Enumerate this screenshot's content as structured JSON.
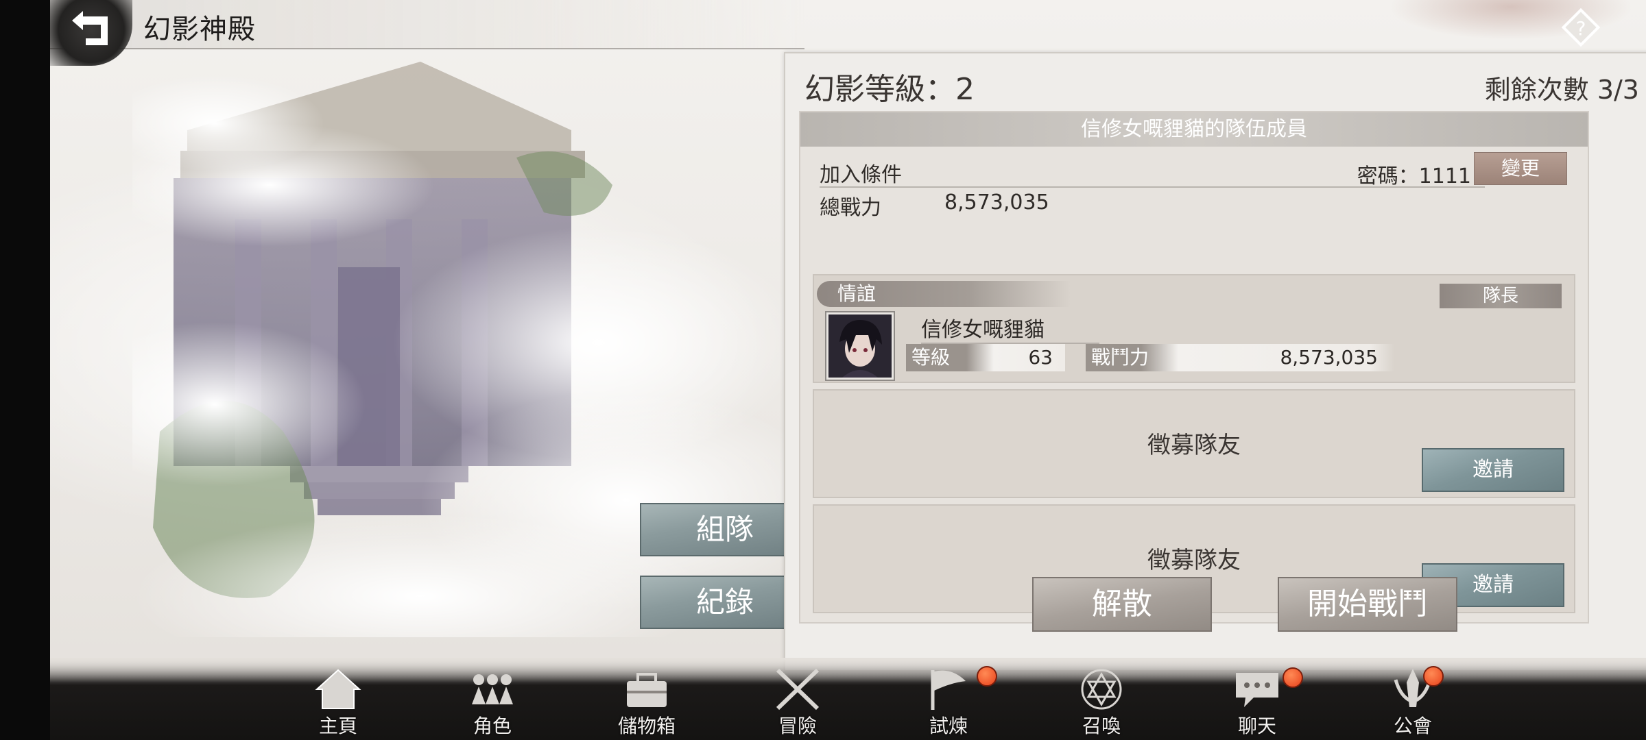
{
  "page": {
    "title": "幻影神殿"
  },
  "panel": {
    "phantom_level": "幻影等級：2",
    "remaining": "剩餘次數 3/3",
    "team_header": "信修女嘅貍貓的隊伍成員",
    "join_label": "加入條件",
    "password": "密碼：1111",
    "change_label": "變更",
    "total_power_label": "總戰力",
    "total_power_value": "8,573,035",
    "member": {
      "tag": "情誼",
      "leader_label": "隊長",
      "name": "信修女嘅貍貓",
      "level_label": "等級",
      "level": "63",
      "power_label": "戰鬥力",
      "power": "8,573,035"
    },
    "slots": [
      {
        "text": "徵募隊友",
        "invite_label": "邀請"
      },
      {
        "text": "徵募隊友",
        "invite_label": "邀請"
      }
    ],
    "disband_label": "解散",
    "start_label": "開始戰鬥"
  },
  "side_buttons": {
    "team_label": "組隊",
    "record_label": "紀錄"
  },
  "nav": [
    {
      "label": "主頁",
      "icon": "home-icon",
      "badge": false
    },
    {
      "label": "角色",
      "icon": "characters-icon",
      "badge": false
    },
    {
      "label": "儲物箱",
      "icon": "storage-box-icon",
      "badge": false
    },
    {
      "label": "冒險",
      "icon": "crossed-swords-icon",
      "badge": false
    },
    {
      "label": "試煉",
      "icon": "flag-icon",
      "badge": true
    },
    {
      "label": "召喚",
      "icon": "hexagram-icon",
      "badge": false
    },
    {
      "label": "聊天",
      "icon": "chat-icon",
      "badge": true
    },
    {
      "label": "公會",
      "icon": "guild-icon",
      "badge": true
    }
  ],
  "colors": {
    "badge": "#e8421b",
    "invite_button": "#7f9599",
    "panel_bg": "#efedea"
  }
}
